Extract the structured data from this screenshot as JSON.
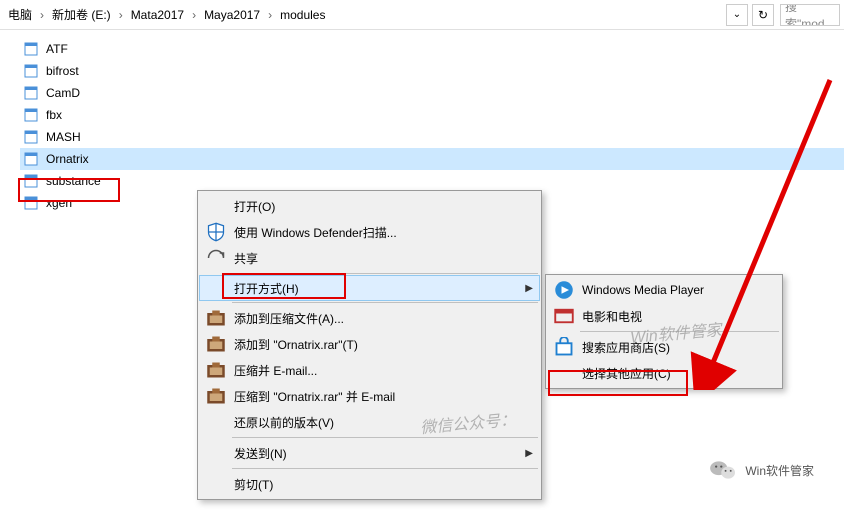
{
  "breadcrumb": {
    "items": [
      "电脑",
      "新加卷 (E:)",
      "Mata2017",
      "Maya2017",
      "modules"
    ],
    "search_placeholder": "搜索\"mod"
  },
  "files": [
    {
      "name": "ATF"
    },
    {
      "name": "bifrost"
    },
    {
      "name": "CamD"
    },
    {
      "name": "fbx"
    },
    {
      "name": "MASH"
    },
    {
      "name": "Ornatrix"
    },
    {
      "name": "substance"
    },
    {
      "name": "xgen"
    }
  ],
  "menu1": {
    "open": "打开(O)",
    "defender": "使用 Windows Defender扫描...",
    "share": "共享",
    "open_with": "打开方式(H)",
    "add_archive": "添加到压缩文件(A)...",
    "add_to_rar": "添加到 \"Ornatrix.rar\"(T)",
    "compress_email": "压缩并 E-mail...",
    "compress_rar_email": "压缩到 \"Ornatrix.rar\" 并 E-mail",
    "restore_prev": "还原以前的版本(V)",
    "send_to": "发送到(N)",
    "cut": "剪切(T)"
  },
  "menu2": {
    "wmp": "Windows Media Player",
    "movies_tv": "电影和电视",
    "search_store": "搜索应用商店(S)",
    "choose_another": "选择其他应用(C)"
  },
  "watermarks": {
    "w1": "微信公众号：",
    "w2": "Win软件管家"
  },
  "badge": {
    "label": "Win软件管家"
  }
}
